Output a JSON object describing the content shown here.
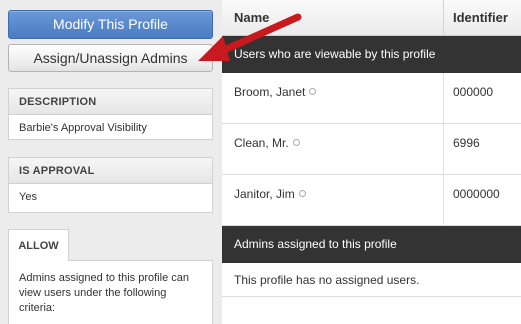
{
  "actions": {
    "modify_label": "Modify This Profile",
    "assign_label": "Assign/Unassign Admins"
  },
  "description": {
    "heading": "DESCRIPTION",
    "value": "Barbie's Approval Visibility"
  },
  "approval": {
    "heading": "IS APPROVAL",
    "value": "Yes"
  },
  "allow": {
    "tab_label": "ALLOW",
    "text": "Admins assigned to this profile can view users under the following criteria:"
  },
  "table": {
    "columns": [
      "Name",
      "Identifier"
    ],
    "users_section": "Users who are viewable by this profile",
    "rows": [
      {
        "name": "Broom, Janet",
        "identifier": "000000"
      },
      {
        "name": "Clean, Mr.",
        "identifier": "6996"
      },
      {
        "name": "Janitor, Jim",
        "identifier": "0000000"
      }
    ],
    "admins_section": "Admins assigned to this profile",
    "admins_empty": "This profile has no assigned users."
  },
  "colors": {
    "primary_button": "#4a7cc4",
    "section_bar": "#333333",
    "annotation_arrow": "#c8191e"
  },
  "icons": {
    "row_info": "info-circle-icon",
    "annotation": "red-arrow-icon"
  }
}
